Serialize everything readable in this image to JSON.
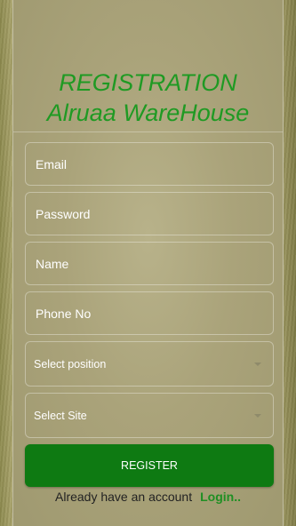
{
  "header": {
    "title_line1": "REGISTRATION",
    "title_line2": "Alruaa WareHouse"
  },
  "form": {
    "email_placeholder": "Email",
    "password_placeholder": "Password",
    "name_placeholder": "Name",
    "phone_placeholder": "Phone No",
    "position_select": "Select position",
    "site_select": "Select Site",
    "register_label": "REGISTER"
  },
  "footer": {
    "text": "Already have an account",
    "login_label": "Login.."
  },
  "colors": {
    "title_green": "#1f9a23",
    "button_green": "#0e7a12",
    "login_green": "#1f8f23"
  }
}
